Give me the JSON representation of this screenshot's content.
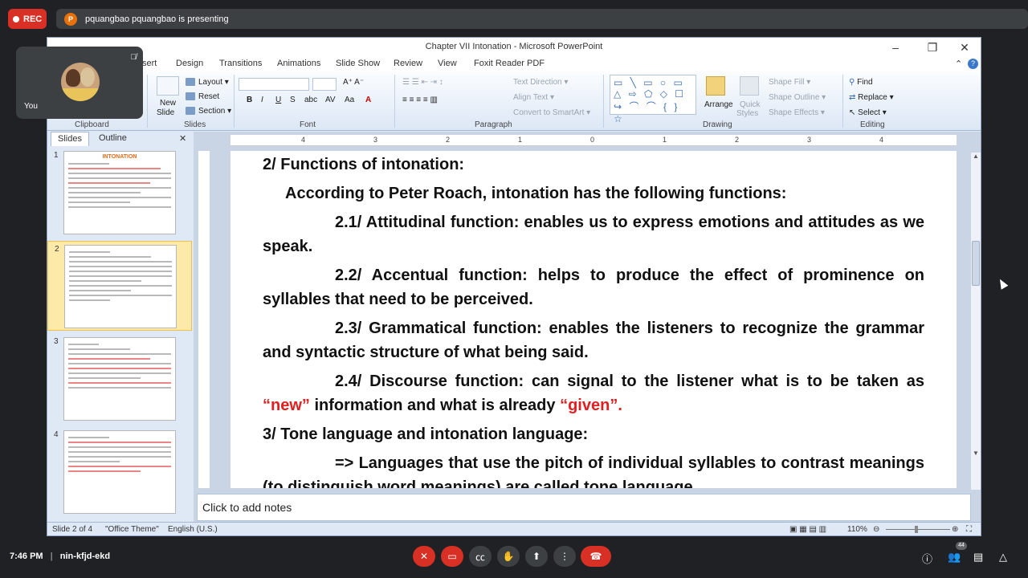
{
  "meet": {
    "rec_label": "REC",
    "presenter_initial": "P",
    "presenting_text": "pquangbao pquangbao is presenting",
    "self_label": "You",
    "time": "7:46 PM",
    "meeting_code": "nin-kfjd-ekd",
    "participants_count": "44"
  },
  "ppt": {
    "window_title": "Chapter VII Intonation - Microsoft PowerPoint",
    "menu": [
      "sert",
      "Design",
      "Transitions",
      "Animations",
      "Slide Show",
      "Review",
      "View",
      "Foxit Reader PDF"
    ],
    "ribbon": {
      "clipboard_label": "Clipboard",
      "new_slide": "New",
      "new_slide2": "Slide",
      "layout": "Layout",
      "reset": "Reset",
      "section": "Section",
      "slides_label": "Slides",
      "font_label": "Font",
      "paragraph_label": "Paragraph",
      "text_direction": "Text Direction",
      "align_text": "Align Text",
      "convert_smartart": "Convert to SmartArt",
      "drawing_label": "Drawing",
      "arrange": "Arrange",
      "quick_styles": "Quick",
      "quick_styles2": "Styles",
      "shape_fill": "Shape Fill",
      "shape_outline": "Shape Outline",
      "shape_effects": "Shape Effects",
      "find": "Find",
      "replace": "Replace",
      "select": "Select",
      "editing_label": "Editing"
    },
    "pane_tabs": [
      "Slides",
      "Outline"
    ],
    "thumb_title_1": "INTONATION",
    "slide_numbers": [
      "1",
      "2",
      "3",
      "4"
    ],
    "ruler": [
      "4",
      "3",
      "2",
      "1",
      "0",
      "1",
      "2",
      "3",
      "4"
    ],
    "slide": {
      "h2": "2/ Functions of intonation:",
      "intro": "According to Peter Roach, intonation has the following functions:",
      "f1": "2.1/ Attitudinal function: enables us  to express emotions and attitudes as we speak.",
      "f2": "2.2/ Accentual function: helps to produce the effect of prominence on syllables that need to be perceived.",
      "f3": "2.3/ Grammatical function: enables the listeners to recognize the grammar and syntactic structure of what being said.",
      "f4_a": "2.4/ Discourse function: can signal to the listener what is to be taken as ",
      "f4_new": "“new”",
      "f4_b": " information and what is already ",
      "f4_given": "“given”.",
      "h3": "3/ Tone language and intonation language:",
      "p3": "=> Languages that use the pitch of individual syllables to contrast meanings (to distinguish word meanings) are called tone language."
    },
    "notes_placeholder": "Click to add notes",
    "status": {
      "slide_of": "Slide 2 of 4",
      "theme": "\"Office Theme\"",
      "language": "English (U.S.)",
      "zoom": "110%"
    }
  }
}
